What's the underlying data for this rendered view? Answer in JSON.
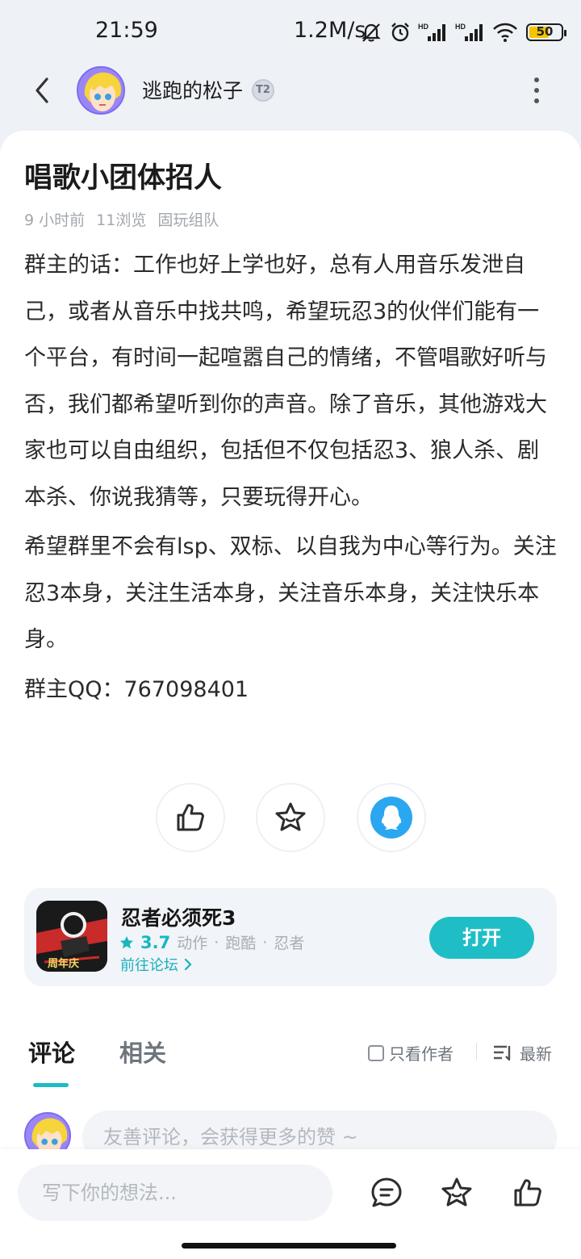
{
  "status_bar": {
    "time": "21:59",
    "network_speed": "1.2M/s",
    "battery": "50",
    "icons": [
      "mute-bell-icon",
      "alarm-icon",
      "hd-signal-icon",
      "hd-signal-icon",
      "wifi-icon",
      "battery-icon"
    ]
  },
  "header": {
    "username": "逃跑的松子",
    "level_badge": "T2"
  },
  "post": {
    "title": "唱歌小团体招人",
    "time_ago": "9 小时前",
    "views": "11浏览",
    "category": "固玩组队",
    "paragraphs": [
      "群主的话：工作也好上学也好，总有人用音乐发泄自己，或者从音乐中找共鸣，希望玩忍3的伙伴们能有一个平台，有时间一起喧嚣自己的情绪，不管唱歌好听与否，我们都希望听到你的声音。除了音乐，其他游戏大家也可以自由组织，包括但不仅包括忍3、狼人杀、剧本杀、你说我猜等，只要玩得开心。",
      "希望群里不会有lsp、双标、以自我为中心等行为。关注忍3本身，关注生活本身，关注音乐本身，关注快乐本身。",
      "群主QQ：767098401"
    ]
  },
  "game": {
    "name": "忍者必须死3",
    "rating": "3.7",
    "tags": [
      "动作",
      "跑酷",
      "忍者"
    ],
    "forum_link": "前往论坛",
    "open_button": "打开",
    "icon_text": "周年庆"
  },
  "comments": {
    "tab_comments": "评论",
    "tab_related": "相关",
    "author_only": "只看作者",
    "sort": "最新",
    "prompt": "友善评论，会获得更多的赞 ~"
  },
  "bottom_bar": {
    "input_placeholder": "写下你的想法..."
  },
  "colors": {
    "accent": "#1fbec6",
    "qq_blue": "#2aa7f0",
    "avatar_purple": "#9b86f6"
  }
}
